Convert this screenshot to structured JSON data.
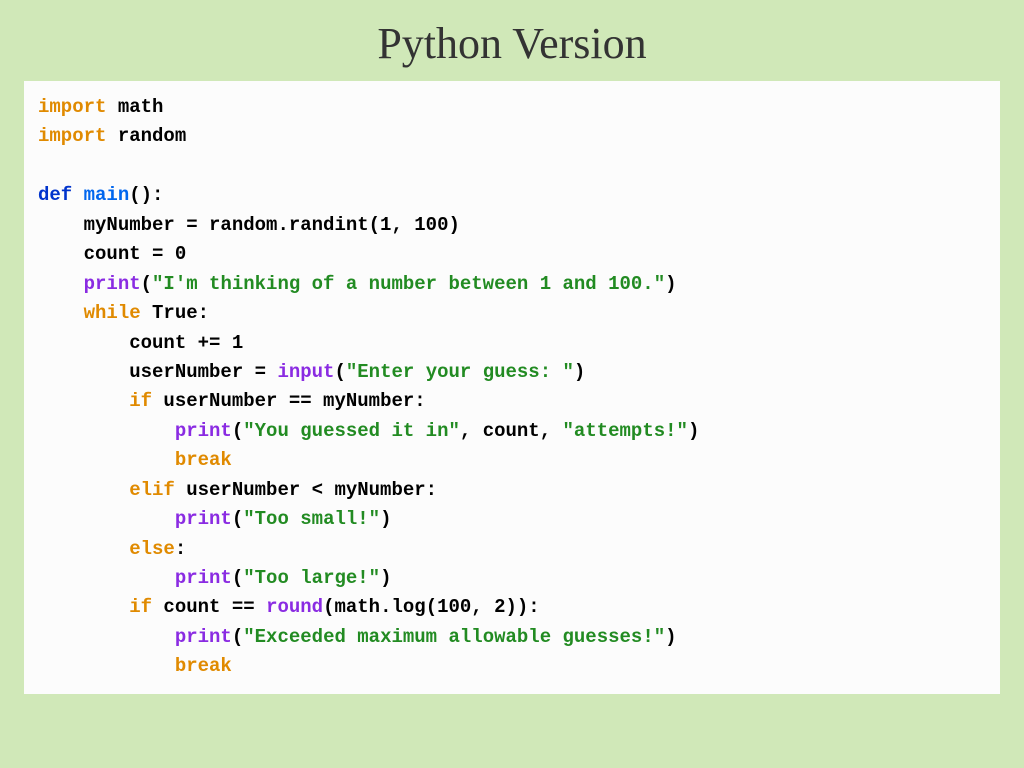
{
  "slide": {
    "title": "Python Version"
  },
  "code": {
    "tokens": {
      "import1": "import",
      "math": " math",
      "import2": "import",
      "random": " random",
      "def": "def",
      "main": " main",
      "parens": "():",
      "line_mynumber": "    myNumber = random.randint(1, 100)",
      "line_count": "    count = 0",
      "indent1": "    ",
      "print1": "print",
      "paren_open1": "(",
      "str_thinking": "\"I'm thinking of a number between 1 and 100.\"",
      "paren_close1": ")",
      "while": "while",
      "true": " True",
      "colon1": ":",
      "line_countinc": "        count += 1",
      "indent2": "        ",
      "usernum_assign": "userNumber = ",
      "input": "input",
      "paren_open2": "(",
      "str_enter": "\"Enter your guess: \"",
      "paren_close2": ")",
      "if1": "if",
      "if1_cond": " userNumber == myNumber:",
      "indent3": "            ",
      "print2": "print",
      "paren_open3": "(",
      "str_guessed": "\"You guessed it in\"",
      "comma_count": ", count, ",
      "str_attempts": "\"attempts!\"",
      "paren_close3": ")",
      "break1": "break",
      "elif": "elif",
      "elif_cond": " userNumber < myNumber:",
      "print3": "print",
      "paren_open4": "(",
      "str_small": "\"Too small!\"",
      "paren_close4": ")",
      "else": "else",
      "colon2": ":",
      "print4": "print",
      "paren_open5": "(",
      "str_large": "\"Too large!\"",
      "paren_close5": ")",
      "if2": "if",
      "if2_cond": " count == ",
      "round": "round",
      "round_args": "(math.log(100, 2)):",
      "print5": "print",
      "paren_open6": "(",
      "str_exceeded": "\"Exceeded maximum allowable guesses!\"",
      "paren_close6": ")",
      "break2": "break"
    }
  }
}
